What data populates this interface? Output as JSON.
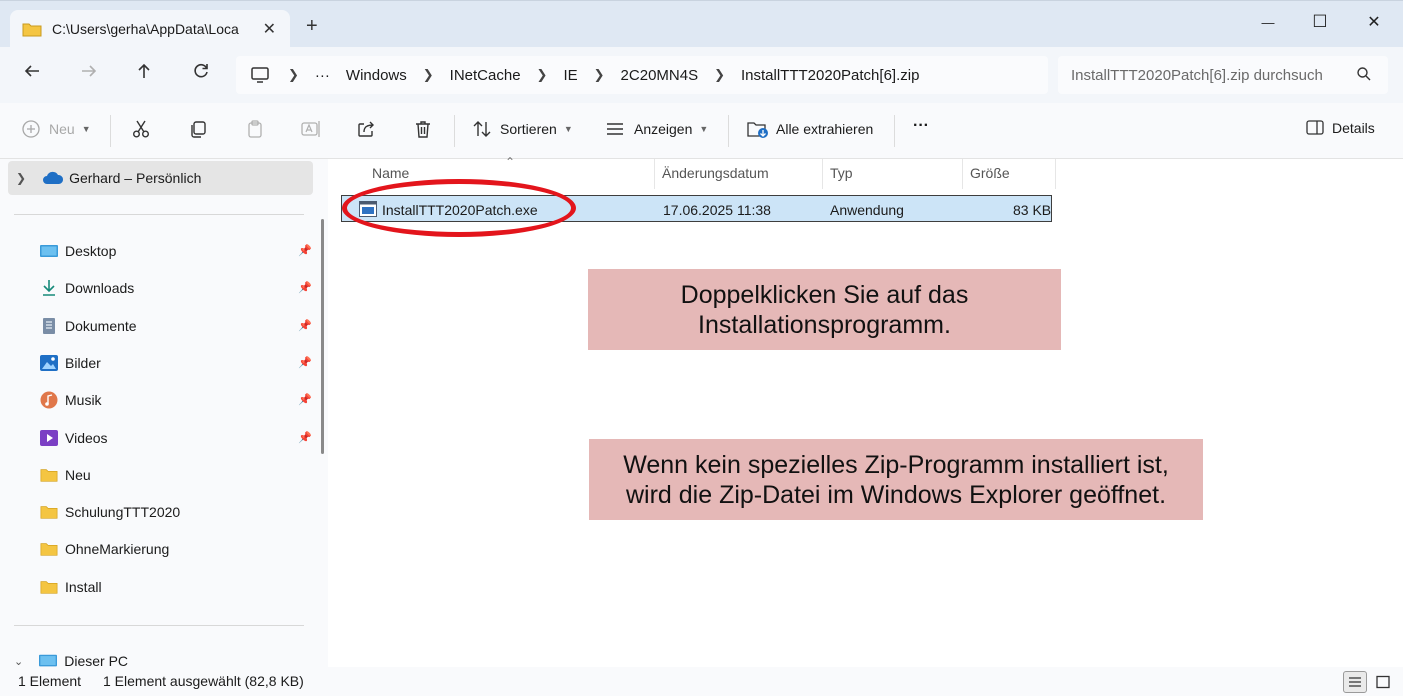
{
  "window": {
    "tab_title": "C:\\Users\\gerha\\AppData\\Loca",
    "tab_close": "✕",
    "new_tab": "+",
    "minimize": "—",
    "maximize": "☐",
    "close": "✕"
  },
  "address": {
    "breadcrumbs": [
      "Windows",
      "INetCache",
      "IE",
      "2C20MN4S",
      "InstallTTT2020Patch[6].zip"
    ],
    "ellipsis": "···",
    "search_placeholder": "InstallTTT2020Patch[6].zip durchsuch"
  },
  "toolbar": {
    "new_label": "Neu",
    "sort_label": "Sortieren",
    "view_label": "Anzeigen",
    "extract_label": "Alle extrahieren",
    "more_label": "···",
    "details_label": "Details"
  },
  "sidebar": {
    "onedrive": "Gerhard – Persönlich",
    "quick_access": [
      {
        "label": "Desktop",
        "icon": "desktop-icon",
        "pinned": true
      },
      {
        "label": "Downloads",
        "icon": "download-icon",
        "pinned": true
      },
      {
        "label": "Dokumente",
        "icon": "document-icon",
        "pinned": true
      },
      {
        "label": "Bilder",
        "icon": "pictures-icon",
        "pinned": true
      },
      {
        "label": "Musik",
        "icon": "music-icon",
        "pinned": true
      },
      {
        "label": "Videos",
        "icon": "videos-icon",
        "pinned": true
      },
      {
        "label": "Neu",
        "icon": "folder-icon",
        "pinned": false
      },
      {
        "label": "SchulungTTT2020",
        "icon": "folder-icon",
        "pinned": false
      },
      {
        "label": "OhneMarkierung",
        "icon": "folder-icon",
        "pinned": false
      },
      {
        "label": "Install",
        "icon": "folder-icon",
        "pinned": false
      }
    ],
    "this_pc": "Dieser PC"
  },
  "file_list": {
    "columns": [
      "Name",
      "Änderungsdatum",
      "Typ",
      "Größe"
    ],
    "rows": [
      {
        "name": "InstallTTT2020Patch.exe",
        "modified": "17.06.2025 11:38",
        "type": "Anwendung",
        "size": "83 KB",
        "selected": true
      }
    ]
  },
  "annotations": {
    "callout_1": "Doppelklicken Sie auf das Installationsprogramm.",
    "callout_2": "Wenn kein spezielles Zip-Programm installiert ist, wird die Zip-Datei im Windows Explorer geöffnet.",
    "highlight_color": "#e3151c",
    "callout_color": "#e5b8b7"
  },
  "status": {
    "item_count": "1 Element",
    "selection": "1 Element ausgewählt (82,8 KB)"
  },
  "colors": {
    "selection_bg": "#cce4f7",
    "titlebar_bg": "#dfe8f3",
    "folder_yellow": "#f4c542"
  }
}
